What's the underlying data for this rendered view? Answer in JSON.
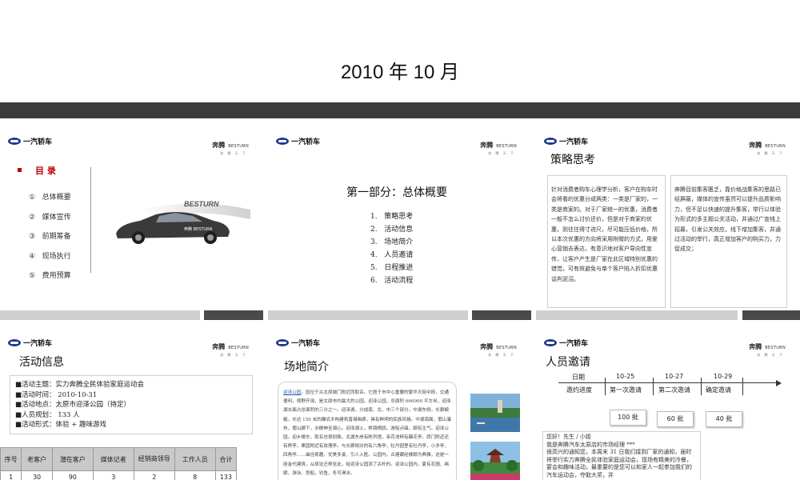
{
  "page_title": "2010 年 10 月",
  "logo": {
    "company": "一汽轿车",
    "brand_cn": "奔腾",
    "brand_en": "BESTURN",
    "brand_sub": "奔 腾 天 下"
  },
  "slide1": {
    "heading": "目 录",
    "items": [
      {
        "num": "①",
        "text": "总体概要"
      },
      {
        "num": "②",
        "text": "媒体宣传"
      },
      {
        "num": "③",
        "text": "前期筹备"
      },
      {
        "num": "④",
        "text": "现场执行"
      },
      {
        "num": "⑤",
        "text": "费用预算"
      }
    ],
    "car_mark": "BESTURN",
    "car_badge": "奔腾 BESTURN"
  },
  "slide2": {
    "heading": "第一部分：总体概要",
    "items": [
      {
        "num": "1.",
        "text": "策略思考"
      },
      {
        "num": "2.",
        "text": "活动信息"
      },
      {
        "num": "3.",
        "text": "场地简介"
      },
      {
        "num": "4.",
        "text": "人员邀请"
      },
      {
        "num": "5.",
        "text": "日程推进"
      },
      {
        "num": "6.",
        "text": "活动流程"
      }
    ]
  },
  "slide3": {
    "heading": "策略思考",
    "left_text": "针对消费者购车心理学分析，客户在购车时会将看的优惠分成两类：一类是厂家的，一类是商家的。对于厂家统一的优惠，消费者一般不怎么讨价还价，但是对于商家的优惠，则往往得寸进尺，尽可能压低价格，所以本次优惠的方向将采用附赠的方式，用爱心营销去表达，有意识地对客户导向性宣传，让客户产生是厂家在此区域特别优惠的错觉，可有效避免与单个客户陷入折扣优惠谈判泥沼。",
    "right_text": "奔腾目前集客匮乏，靠价格战集客的思路已经屏蔽，媒体的宣传虽然可以提升品质影响力，但不足以快速的提升集客，举行以体验为形式的多主题公关活动，并通过广宣线上招募，引发公关效应，线下增加集客，并通过活动的举行，真正增加客户的购买力，力促成交；"
  },
  "slide4": {
    "heading": "活动信息",
    "info": [
      "■活动主题：实力奔腾全民体验家庭运动会",
      "■活动时间：  2010-10-31",
      "■活动地点：太原市迎泽公园（待定）",
      "■人员规划：  133 人",
      "■活动形式：体验 + 趣味游戏"
    ],
    "table_head": [
      "序号",
      "老客户",
      "潜在客户",
      "媒体记者",
      "经销商领导",
      "工作人员",
      "合计"
    ],
    "table_row": [
      "1",
      "30",
      "90",
      "3",
      "2",
      "8",
      "133"
    ]
  },
  "slide5": {
    "heading": "场地简介",
    "park_link": "迎泽公园",
    "text": "，因位于古太原城门附近而取名。它居于市中心重要的繁华大街中段，交通便利，视野开阔，是太原市内最大的公园。迎泽公园，总面积 666900 平方米，迎泽湖水面占总面积的三分之一。迎泽湖，分成南、北、中三个部分，中湖东侧，长廊蜿蜒，长达 150 米的雕式木构建筑晋凝画廊，具有鲜明的民族风格。中湖南面，假山瀑布，假山脚下，水榭伸至湖心。迎泽湖上，移镜栖鸥，游船点缀，颇有生气。迎泽公园，迎乡楼东，取名也很别致。北湖东岸有陈列馆，亲花池畔有藕花亭，西门附近还有熊亭，果园附近有玫瑰亭。与长廊相对的有六角亭，牡丹园里有牡丹亭，小矛亭，四角亭……曲径奇趣，优美多姿，引人入胜。公园内，古建藏经楼颇为典雅，这是一座金代建筑，从原址迁移至此，给迎泽公园添了古朴的。迎泽公园内，夏有花圃、画廊，游泳、划船，钓鱼，冬可滑冰。"
  },
  "slide6": {
    "heading": "人员邀请",
    "timeline_label": "日期",
    "dates": [
      "10-25",
      "10-27",
      "10-29"
    ],
    "progress_label": "邀约进度",
    "phases": [
      "第一次邀请",
      "第二次邀请",
      "确定邀请"
    ],
    "counts": [
      "100 批",
      "60 批",
      "40 批"
    ],
    "letter": [
      "您好！先生 / 小姐",
      "我是奔腾汽车太原店的市场经理 ***",
      "很高兴的通知您，本周末 31 日我们接到厂家的通知，届时将举行实力奔腾全民体验家庭运动会，现场有精美的冷餐，宴会和趣味活动，最重要的是您可以和家人一起参加我们的汽车运动会，夺取大奖，并"
    ]
  }
}
